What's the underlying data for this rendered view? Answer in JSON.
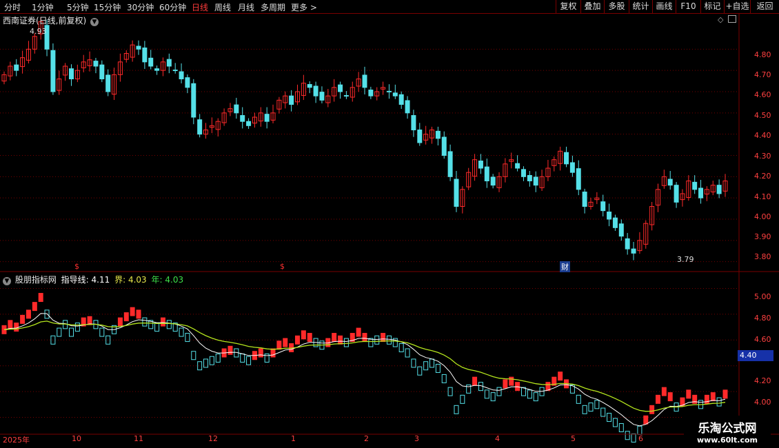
{
  "toolbar": {
    "timeframes": [
      "分时",
      "1分钟",
      "5分钟",
      "15分钟",
      "30分钟",
      "60分钟",
      "日线",
      "周线",
      "月线",
      "多周期",
      "更多 >"
    ],
    "active_timeframe": "日线",
    "buttons": [
      "复权",
      "叠加",
      "多股",
      "统计",
      "画线",
      "F10",
      "标记",
      "+自选",
      "返回"
    ]
  },
  "main_chart": {
    "title": "西南证券(日线,前复权)",
    "high_label": "4.93",
    "low_label": "3.79",
    "price_ticks": [
      "4.80",
      "4.70",
      "4.60",
      "4.50",
      "4.40",
      "4.30",
      "4.20",
      "4.10",
      "4.00",
      "3.90",
      "3.80"
    ],
    "markers": [
      "$",
      "$",
      "财"
    ]
  },
  "indicator": {
    "name": "股朋指标网",
    "line1_label": "指导线:",
    "line1_value": "4.11",
    "line2_label": "界:",
    "line2_value": "4.03",
    "line3_label": "年:",
    "line3_value": "4.03",
    "ticks": [
      "5.00",
      "4.80",
      "4.60",
      "4.40",
      "4.20",
      "4.00"
    ],
    "current_price": "4.40"
  },
  "date_axis": [
    "2025年",
    "10",
    "11",
    "12",
    "1",
    "2",
    "3",
    "4",
    "5",
    "6"
  ],
  "watermark": {
    "line1": "乐淘公式网",
    "line2": "www.60lt.com"
  },
  "colors": {
    "up": "#ff2a2a",
    "down": "#55e0e8",
    "grid": "#7a0000",
    "guide": "#ffffff",
    "limit": "#b5e61d"
  },
  "chart_data": {
    "type": "candlestick",
    "title": "西南证券(日线,前复权)",
    "ylim": [
      3.76,
      4.96
    ],
    "high": 4.93,
    "low": 3.79,
    "dates": [
      "2025年",
      "10",
      "11",
      "12",
      "1",
      "2",
      "3",
      "4",
      "5",
      "6"
    ],
    "closes": [
      4.68,
      4.72,
      4.7,
      4.76,
      4.8,
      4.86,
      4.93,
      4.8,
      4.6,
      4.66,
      4.72,
      4.66,
      4.7,
      4.74,
      4.75,
      4.72,
      4.66,
      4.6,
      4.68,
      4.74,
      4.78,
      4.82,
      4.8,
      4.74,
      4.72,
      4.7,
      4.74,
      4.72,
      4.7,
      4.66,
      4.62,
      4.48,
      4.4,
      4.42,
      4.44,
      4.46,
      4.5,
      4.52,
      4.5,
      4.46,
      4.44,
      4.48,
      4.5,
      4.46,
      4.5,
      4.56,
      4.58,
      4.54,
      4.6,
      4.64,
      4.62,
      4.58,
      4.56,
      4.58,
      4.62,
      4.6,
      4.58,
      4.62,
      4.66,
      4.62,
      4.58,
      4.6,
      4.62,
      4.6,
      4.58,
      4.54,
      4.5,
      4.42,
      4.36,
      4.4,
      4.42,
      4.38,
      4.3,
      4.2,
      4.06,
      4.14,
      4.22,
      4.28,
      4.24,
      4.18,
      4.16,
      4.2,
      4.26,
      4.28,
      4.24,
      4.2,
      4.18,
      4.16,
      4.2,
      4.24,
      4.28,
      4.32,
      4.26,
      4.22,
      4.14,
      4.06,
      4.08,
      4.1,
      4.04,
      4.0,
      3.96,
      3.92,
      3.86,
      3.84,
      3.9,
      3.98,
      4.06,
      4.14,
      4.2,
      4.16,
      4.08,
      4.12,
      4.18,
      4.14,
      4.1,
      4.14,
      4.16,
      4.12,
      4.18
    ],
    "indicator_series": [
      {
        "name": "指导线",
        "value": 4.11
      },
      {
        "name": "界",
        "value": 4.03
      },
      {
        "name": "年",
        "value": 4.03
      }
    ],
    "indicator_ylim": [
      3.88,
      5.12
    ]
  }
}
